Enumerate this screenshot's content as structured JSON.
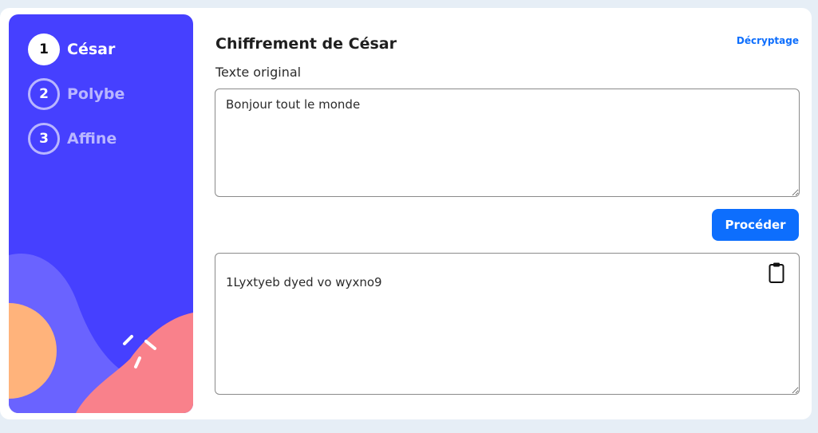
{
  "steps": [
    {
      "number": "1",
      "label": "César"
    },
    {
      "number": "2",
      "label": "Polybe"
    },
    {
      "number": "3",
      "label": "Affine"
    }
  ],
  "main": {
    "title": "Chiffrement de César",
    "toggle_link": "Décryptage",
    "input_label": "Texte original",
    "input_value": "Bonjour tout le monde",
    "proceed_label": "Procéder",
    "output_value": "1Lyxtyeb dyed vo wyxno9"
  },
  "icons": {
    "copy": "clipboard-icon"
  },
  "colors": {
    "sidebar": "#4640ff",
    "accent": "#0d6efd",
    "background": "#e6eef6",
    "blob_purple": "#6a63ff",
    "blob_orange": "#ffb37b",
    "blob_pink": "#f9818b"
  }
}
